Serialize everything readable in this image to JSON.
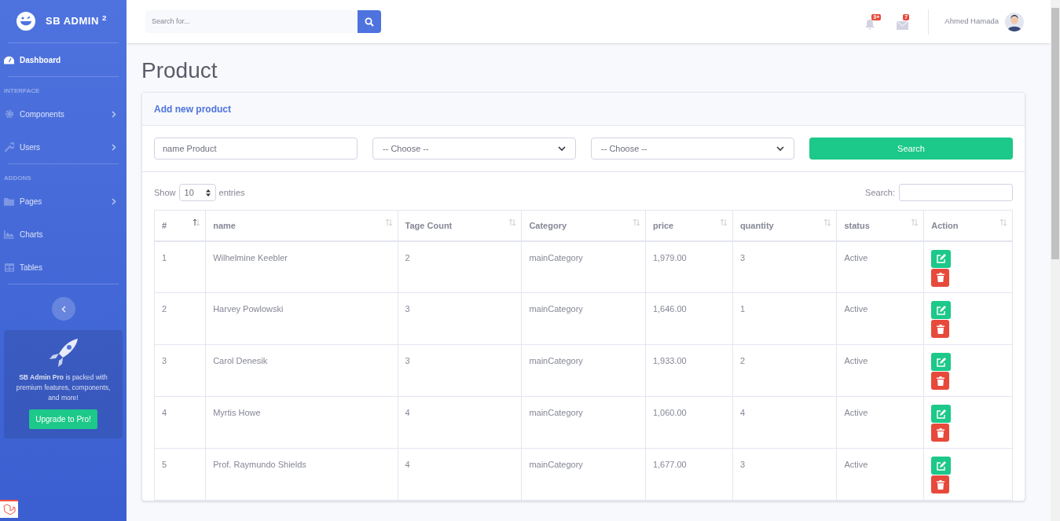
{
  "brand": {
    "name": "SB ADMIN",
    "sup": "2"
  },
  "sidebar": {
    "items": [
      {
        "kind": "link",
        "label": "Dashboard",
        "selected": true,
        "collapsible": false
      },
      {
        "kind": "heading",
        "label": "INTERFACE"
      },
      {
        "kind": "link",
        "label": "Components",
        "selected": false,
        "collapsible": true
      },
      {
        "kind": "link",
        "label": "Users",
        "selected": false,
        "collapsible": true
      },
      {
        "kind": "heading",
        "label": "ADDONS"
      },
      {
        "kind": "link",
        "label": "Pages",
        "selected": false,
        "collapsible": true
      },
      {
        "kind": "link",
        "label": "Charts",
        "selected": false,
        "collapsible": false
      },
      {
        "kind": "link",
        "label": "Tables",
        "selected": false,
        "collapsible": false
      }
    ],
    "promo": {
      "text": "**SB Admin Pro** is packed with premium features, components, and more!",
      "button": "Upgrade to Pro!"
    }
  },
  "topbar": {
    "search": {
      "placeholder": "Search for..."
    },
    "alerts_badge": "3+",
    "messages_badge": "7",
    "user": "Ahmed Hamada"
  },
  "page_title": "Product",
  "card": {
    "header": "Add new product",
    "filters": {
      "name": {
        "placeholder": "name Product"
      },
      "select_1": "-- Choose --",
      "select_2": "-- Choose --",
      "button": "Search"
    },
    "table": {
      "length": {
        "before": "Show",
        "value": "10",
        "after": "entries"
      },
      "search_label": "Search:",
      "columns": [
        {
          "label": "#",
          "sorted": true
        },
        {
          "label": "name",
          "sorted": false
        },
        {
          "label": "Tage Count",
          "sorted": false
        },
        {
          "label": "Category",
          "sorted": false
        },
        {
          "label": "price",
          "sorted": false
        },
        {
          "label": "quantity",
          "sorted": false
        },
        {
          "label": "status",
          "sorted": false
        },
        {
          "label": "Action",
          "sorted": false
        }
      ],
      "rows": [
        [
          "1",
          "Wilhelmine Keebler",
          "2",
          "mainCategory",
          "1,979.00",
          "3",
          "Active"
        ],
        [
          "2",
          "Harvey Powlowski",
          "3",
          "mainCategory",
          "1,646.00",
          "1",
          "Active"
        ],
        [
          "3",
          "Carol Denesik",
          "3",
          "mainCategory",
          "1,933.00",
          "2",
          "Active"
        ],
        [
          "4",
          "Myrtis Howe",
          "4",
          "mainCategory",
          "1,060.00",
          "4",
          "Active"
        ],
        [
          "5",
          "Prof. Raymundo Shields",
          "4",
          "mainCategory",
          "1,677.00",
          "3",
          "Active"
        ]
      ]
    }
  }
}
